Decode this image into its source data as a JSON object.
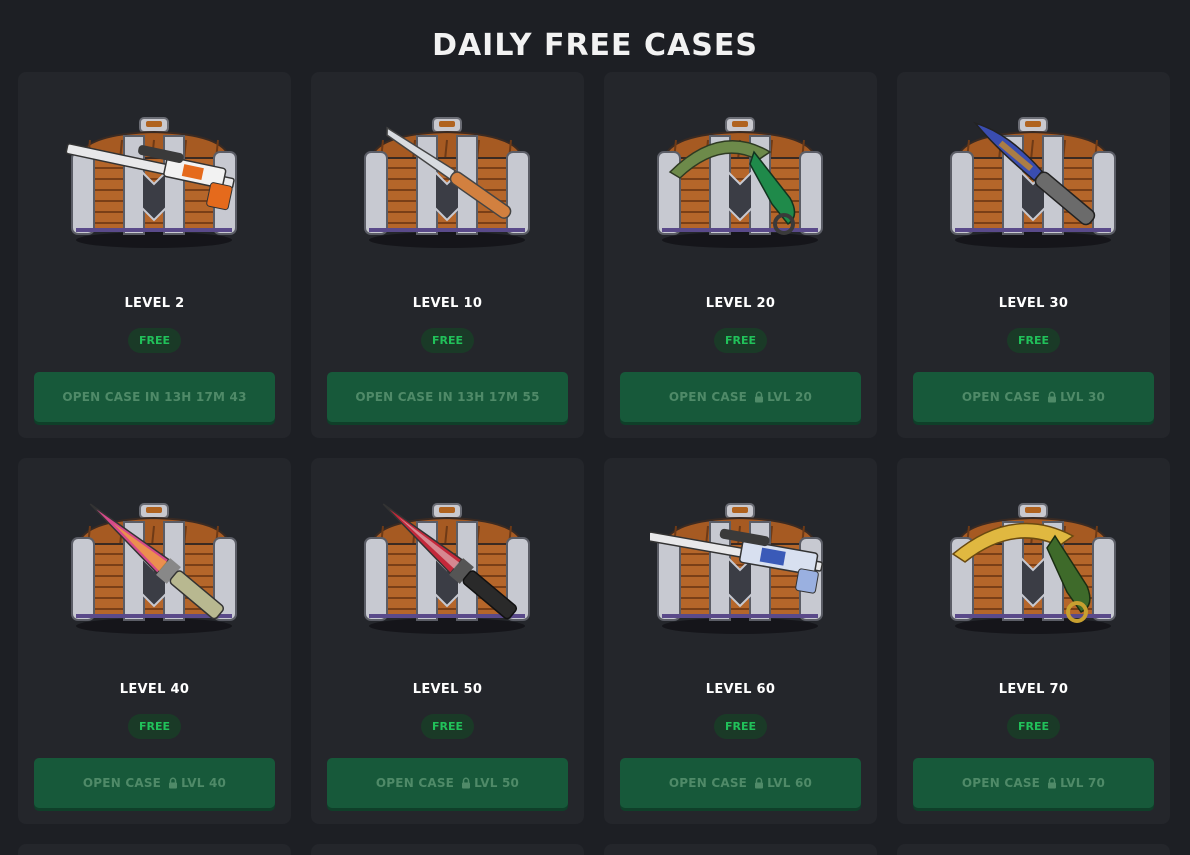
{
  "title": "DAILY FREE CASES",
  "cards": [
    {
      "level": "LEVEL 2",
      "badge": "FREE",
      "button": {
        "label": "OPEN CASE IN 13H  17M  43",
        "lvl": ""
      },
      "weapon": "rifle-orange"
    },
    {
      "level": "LEVEL 10",
      "badge": "FREE",
      "button": {
        "label": "OPEN CASE IN 13H  17M  55",
        "lvl": ""
      },
      "weapon": "knife-flip"
    },
    {
      "level": "LEVEL 20",
      "badge": "FREE",
      "button": {
        "label": "OPEN CASE",
        "lvl": "LVL 20"
      },
      "weapon": "karambit-green"
    },
    {
      "level": "LEVEL 30",
      "badge": "FREE",
      "button": {
        "label": "OPEN CASE",
        "lvl": "LVL 30"
      },
      "weapon": "knife-falchion"
    },
    {
      "level": "LEVEL 40",
      "badge": "FREE",
      "button": {
        "label": "OPEN CASE",
        "lvl": "LVL 40"
      },
      "weapon": "bayonet-fade"
    },
    {
      "level": "LEVEL 50",
      "badge": "FREE",
      "button": {
        "label": "OPEN CASE",
        "lvl": "LVL 50"
      },
      "weapon": "bayonet-red"
    },
    {
      "level": "LEVEL 60",
      "badge": "FREE",
      "button": {
        "label": "OPEN CASE",
        "lvl": "LVL 60"
      },
      "weapon": "rifle-blue"
    },
    {
      "level": "LEVEL 70",
      "badge": "FREE",
      "button": {
        "label": "OPEN CASE",
        "lvl": "LVL 70"
      },
      "weapon": "karambit-gold"
    }
  ],
  "colors": {
    "background": "#1d1f24",
    "card": "#24262b",
    "button": "#17593a",
    "badge_text": "#21c15a"
  }
}
